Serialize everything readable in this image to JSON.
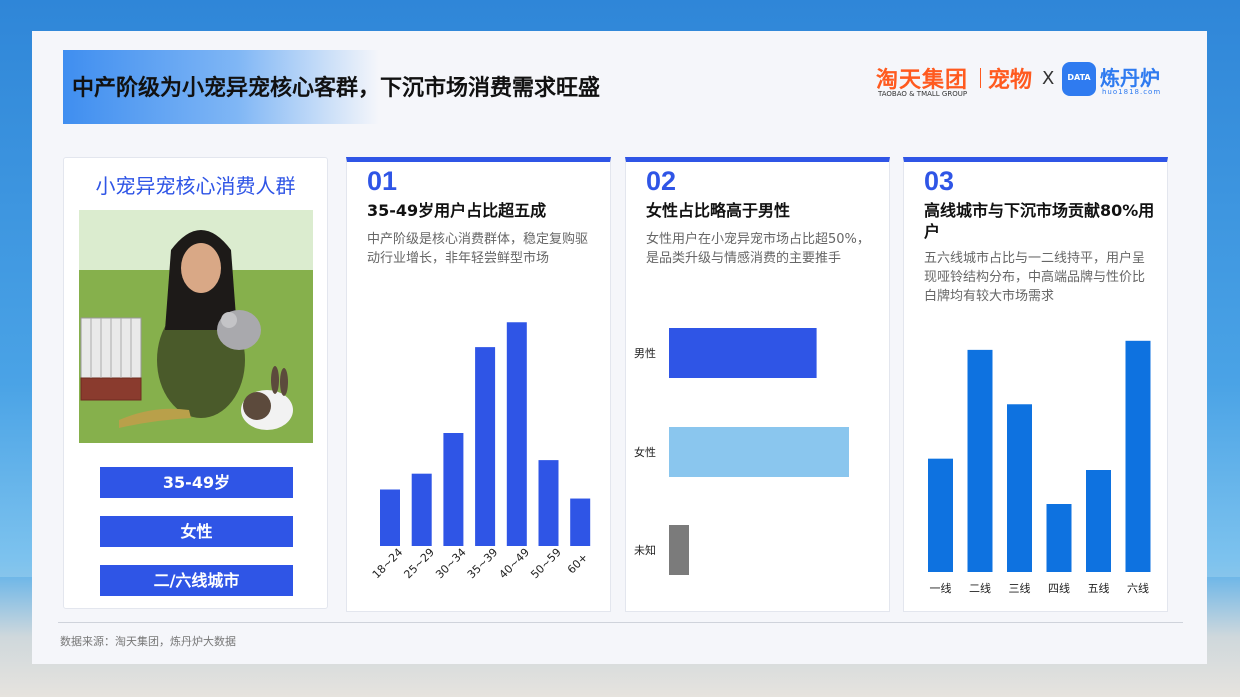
{
  "header": {
    "title": "中产阶级为小宠异宠核心客群，下沉市场消费需求旺盛",
    "logo_tmall": "淘天集团",
    "logo_tmall_sub": "TAOBAO & TMALL GROUP",
    "logo_pet": "宠物",
    "logo_x": "X",
    "logo_lian": "炼丹炉",
    "logo_url": "huo1818.com",
    "logo_badge": "DATA"
  },
  "left_panel": {
    "title": "小宠异宠核心消费人群",
    "tags": [
      "35-49岁",
      "女性",
      "二/六线城市"
    ]
  },
  "panels": [
    {
      "num": "01",
      "head": "35-49岁用户占比超五成",
      "desc": "中产阶级是核心消费群体，稳定复购驱动行业增长，非年轻尝鲜型市场"
    },
    {
      "num": "02",
      "head": "女性占比略高于男性",
      "desc": "女性用户在小宠异宠市场占比超50%，是品类升级与情感消费的主要推手"
    },
    {
      "num": "03",
      "head": "高线城市与下沉市场贡献80%用户",
      "desc": "五六线城市占比与一二线持平，用户呈现哑铃结构分布，中高端品牌与性价比白牌均有较大市场需求"
    }
  ],
  "chart_data": [
    {
      "type": "bar",
      "categories": [
        "18~24",
        "25~29",
        "30~34",
        "35~39",
        "40~49",
        "50~59",
        "60+"
      ],
      "values": [
        25,
        32,
        50,
        88,
        99,
        38,
        21
      ],
      "ylim": [
        0,
        100
      ],
      "color": "#2f55e6"
    },
    {
      "type": "bar",
      "orientation": "horizontal",
      "categories": [
        "男性",
        "女性",
        "未知"
      ],
      "values": [
        82,
        100,
        11
      ],
      "colors": [
        "#2f55e6",
        "#8ac6ee",
        "#7b7b7b"
      ],
      "xlim": [
        0,
        100
      ]
    },
    {
      "type": "bar",
      "categories": [
        "一线",
        "二线",
        "三线",
        "四线",
        "五线",
        "六线"
      ],
      "values": [
        50,
        98,
        74,
        30,
        45,
        102
      ],
      "ylim": [
        0,
        105
      ],
      "color": "#0e72e0"
    }
  ],
  "footer": {
    "source": "数据来源：淘天集团，炼丹炉大数据"
  }
}
